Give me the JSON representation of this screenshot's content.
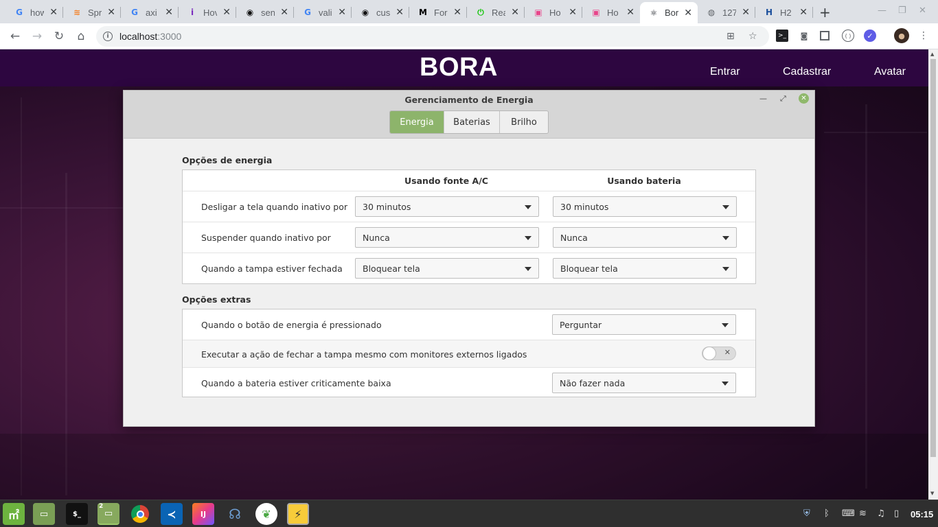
{
  "browser": {
    "tabs": [
      {
        "label": "how",
        "favicon": "G",
        "icon_color": "#4285f4"
      },
      {
        "label": "Spr",
        "favicon": "≋",
        "icon_color": "#f48024"
      },
      {
        "label": "axi",
        "favicon": "G",
        "icon_color": "#4285f4"
      },
      {
        "label": "Hov",
        "favicon": "i",
        "icon_color": "#7b2cbf"
      },
      {
        "label": "sen",
        "favicon": "◉",
        "icon_color": "#111111"
      },
      {
        "label": "vali",
        "favicon": "G",
        "icon_color": "#4285f4"
      },
      {
        "label": "cus",
        "favicon": "◉",
        "icon_color": "#111111"
      },
      {
        "label": "For",
        "favicon": "M",
        "icon_color": "#000000"
      },
      {
        "label": "Rea",
        "favicon": "⏻",
        "icon_color": "#16c60c"
      },
      {
        "label": "Ho",
        "favicon": "▣",
        "icon_color": "#e8458b"
      },
      {
        "label": "Ho",
        "favicon": "▣",
        "icon_color": "#e8458b"
      },
      {
        "label": "Bor",
        "favicon": "⚛",
        "icon_color": "#20232a",
        "active": true
      },
      {
        "label": "127",
        "favicon": "◍",
        "icon_color": "#5f6368"
      },
      {
        "label": "H2",
        "favicon": "H",
        "icon_color": "#1b4f9c"
      }
    ],
    "url_host": "localhost",
    "url_port": ":3000"
  },
  "app": {
    "brand": "BORA",
    "nav": {
      "login": "Entrar",
      "register": "Cadastrar",
      "avatar": "Avatar"
    }
  },
  "dialog": {
    "title": "Gerenciamento de Energia",
    "tabs": [
      "Energia",
      "Baterias",
      "Brilho"
    ],
    "active_tab": "Energia",
    "power_section": {
      "title": "Opções de energia",
      "col_ac": "Usando fonte A/C",
      "col_battery": "Usando bateria",
      "rows": [
        {
          "label": "Desligar a tela quando inativo por",
          "ac": "30 minutos",
          "battery": "30 minutos"
        },
        {
          "label": "Suspender quando inativo por",
          "ac": "Nunca",
          "battery": "Nunca"
        },
        {
          "label": "Quando a tampa estiver fechada",
          "ac": "Bloquear tela",
          "battery": "Bloquear tela"
        }
      ]
    },
    "extra_section": {
      "title": "Opções extras",
      "power_button_label": "Quando o botão de energia é pressionado",
      "power_button_value": "Perguntar",
      "lid_external_label": "Executar a ação de fechar a tampa mesmo com monitores externos ligados",
      "lid_external_enabled": false,
      "critical_battery_label": "Quando a bateria estiver criticamente baixa",
      "critical_battery_value": "Não fazer nada"
    },
    "accent_color": "#8db46b"
  },
  "taskbar": {
    "workspace_badge": "2",
    "clock": "05:15"
  }
}
